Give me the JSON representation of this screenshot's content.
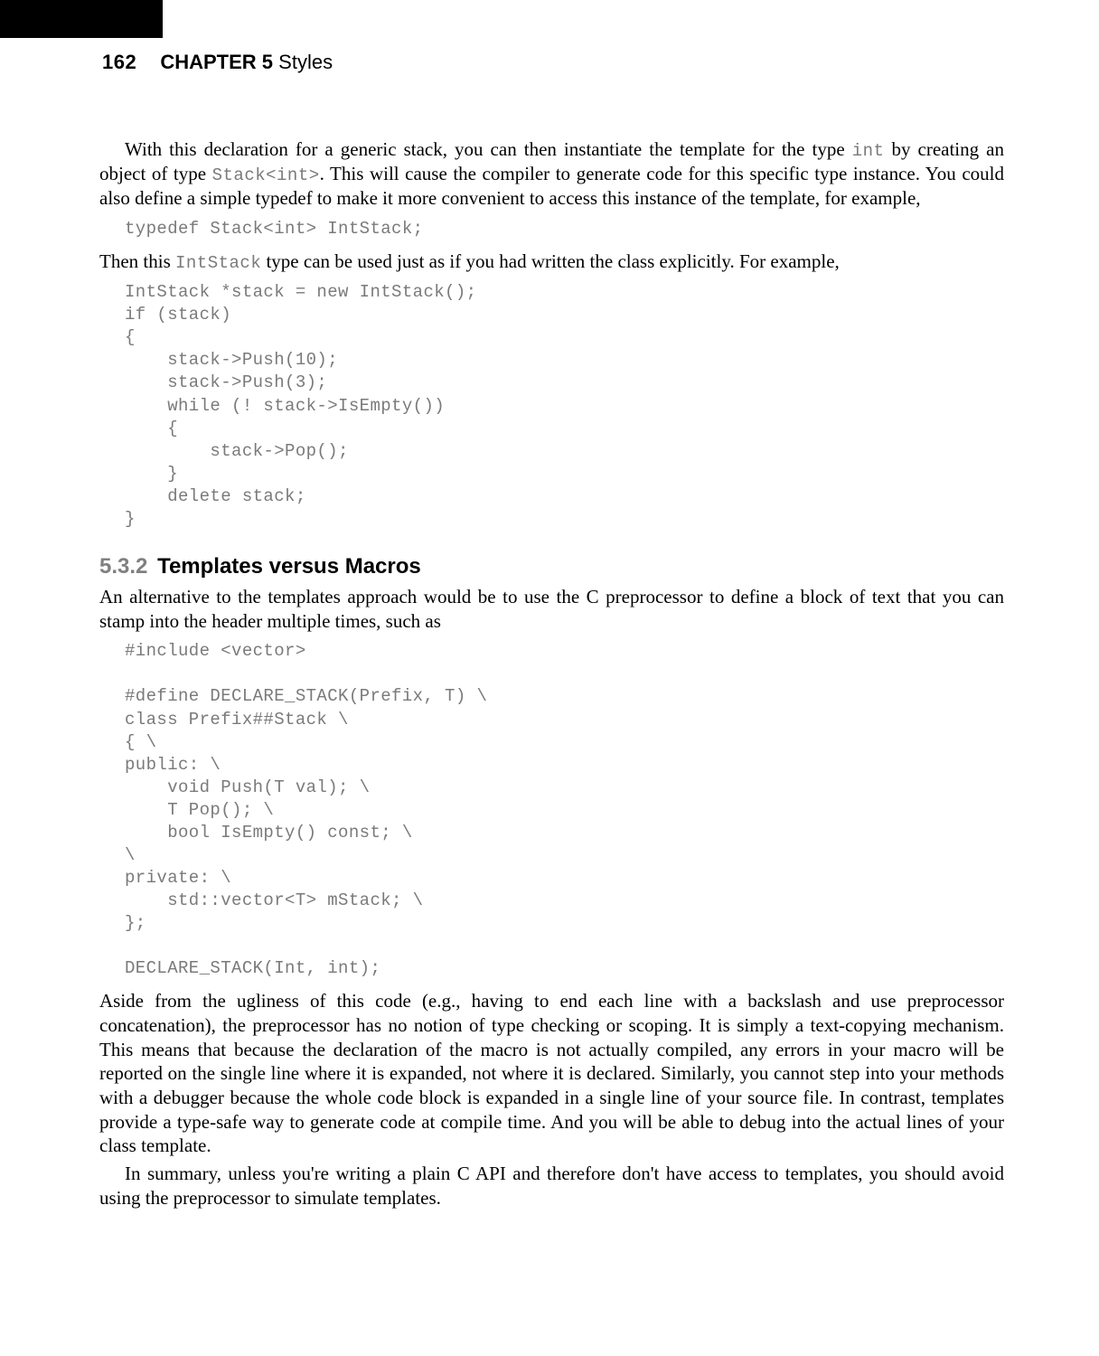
{
  "header": {
    "page_number": "162",
    "chapter_label": "CHAPTER 5",
    "chapter_title": "Styles"
  },
  "para1_a": "With this declaration for a generic stack, you can then instantiate the template for the type ",
  "para1_code1": "int",
  "para1_b": " by creating an object of type ",
  "para1_code2": "Stack<int>",
  "para1_c": ". This will cause the compiler to generate code for this specific type instance. You could also define a simple typedef to make it more convenient to access this instance of the template, for example,",
  "code_typedef": "typedef Stack<int> IntStack;",
  "para2_a": "Then this ",
  "para2_code1": "IntStack",
  "para2_b": " type can be used just as if you had written the class explicitly. For example,",
  "code_intstack": "IntStack *stack = new IntStack();\nif (stack)\n{\n    stack->Push(10);\n    stack->Push(3);\n    while (! stack->IsEmpty())\n    {\n        stack->Pop();\n    }\n    delete stack;\n}",
  "section_num": "5.3.2",
  "section_title": "Templates versus Macros",
  "para3": "An alternative to the templates approach would be to use the C preprocessor to define a block of text that you can stamp into the header multiple times, such as",
  "code_macro": "#include <vector>\n\n#define DECLARE_STACK(Prefix, T) \\\nclass Prefix##Stack \\\n{ \\\npublic: \\\n    void Push(T val); \\\n    T Pop(); \\\n    bool IsEmpty() const; \\\n\\\nprivate: \\\n    std::vector<T> mStack; \\\n};\n\nDECLARE_STACK(Int, int);",
  "para4": "Aside from the ugliness of this code (e.g., having to end each line with a backslash and use preprocessor concatenation), the preprocessor has no notion of type checking or scoping. It is simply a text-copying mechanism. This means that because the declaration of the macro is not actually compiled, any errors in your macro will be reported on the single line where it is expanded, not where it is declared. Similarly, you cannot step into your methods with a debugger because the whole code block is expanded in a single line of your source file. In contrast, templates provide a type-safe way to generate code at compile time. And you will be able to debug into the actual lines of your class template.",
  "para5": "In summary, unless you're writing a plain C API and therefore don't have access to templates, you should avoid using the preprocessor to simulate templates."
}
